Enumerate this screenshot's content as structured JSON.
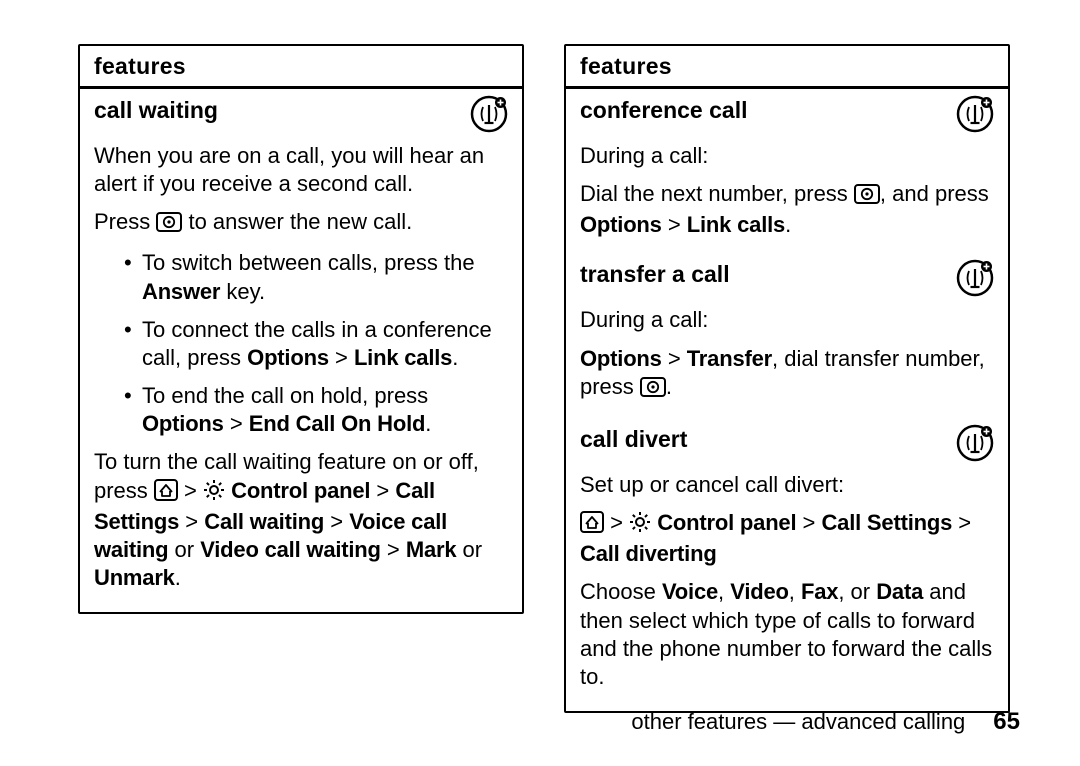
{
  "left": {
    "header": "features",
    "section1": {
      "title": "call waiting",
      "p1": "When you are on a call, you will hear an alert if you receive a second call.",
      "p2a": "Press ",
      "p2b": " to answer the new call.",
      "bul1a": "To switch between calls, press the ",
      "bul1b": "Answer",
      "bul1c": " key.",
      "bul2a": "To connect the calls in a conference call, press ",
      "bul2b": "Options",
      "bul2c": " > ",
      "bul2d": "Link calls",
      "bul2e": ".",
      "bul3a": "To end the call on hold, press ",
      "bul3b": "Options",
      "bul3c": " > ",
      "bul3d": "End Call On Hold",
      "bul3e": ".",
      "p3a": "To turn the call waiting feature on or off, press ",
      "p3b": " > ",
      "p3c": "Control panel",
      "p3d": " > ",
      "p3e": "Call Settings",
      "p3f": " > ",
      "p3g": "Call waiting",
      "p3h": " > ",
      "p3i": "Voice call waiting",
      "p3j": " or ",
      "p3k": "Video call waiting",
      "p3l": " > ",
      "p3m": "Mark",
      "p3n": " or ",
      "p3o": "Unmark",
      "p3p": "."
    }
  },
  "right": {
    "header": "features",
    "conf": {
      "title": "conference call",
      "p1": "During a call:",
      "p2a": "Dial the next number, press ",
      "p2b": ", and press ",
      "p2c": "Options",
      "p2d": " > ",
      "p2e": "Link calls",
      "p2f": "."
    },
    "transfer": {
      "title": "transfer a call",
      "p1": "During a call:",
      "p2a": "Options",
      "p2b": " > ",
      "p2c": "Transfer",
      "p2d": ", dial transfer number, press ",
      "p2e": "."
    },
    "divert": {
      "title": "call divert",
      "p1": "Set up or cancel call divert:",
      "p2a": " > ",
      "p2b": "Control panel",
      "p2c": " > ",
      "p2d": "Call Settings",
      "p2e": " > ",
      "p2f": "Call diverting",
      "p3a": "Choose ",
      "p3b": "Voice",
      "p3c": ", ",
      "p3d": "Video",
      "p3e": ", ",
      "p3f": "Fax",
      "p3g": ", or ",
      "p3h": "Data",
      "p3i": " and then select which type of calls to forward and the phone number to forward the calls to."
    }
  },
  "footer": {
    "text": "other features — advanced calling",
    "page": "65"
  },
  "icons": {
    "antenna": "antenna-icon",
    "send": "send-key-icon",
    "home": "home-key-icon",
    "gear": "gear-icon"
  }
}
